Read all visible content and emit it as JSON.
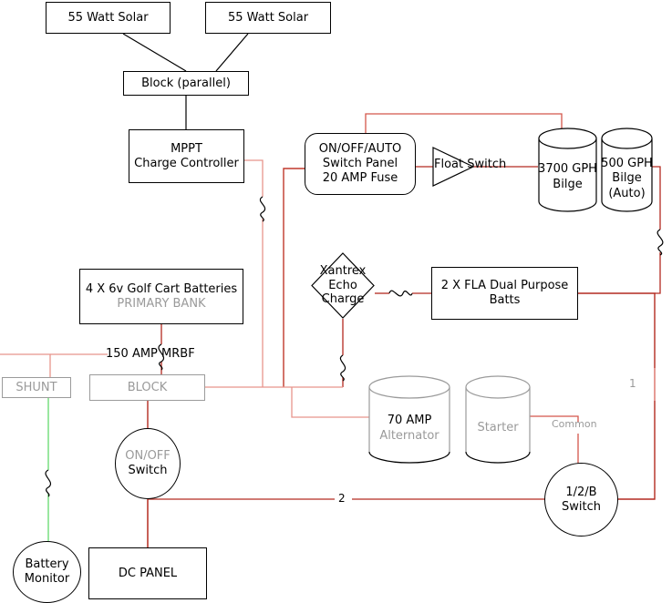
{
  "diagram": {
    "title": "Boat DC Electrical Wiring Diagram",
    "colors": {
      "wire_red_dark": "#b42a20",
      "wire_red_light": "#e8948c",
      "wire_red_mid": "#d4564a",
      "wire_green": "#6fdd78",
      "outline_black": "#000000",
      "outline_gray": "#9b9b9b",
      "text_black": "#000000",
      "text_gray": "#9a9a9a",
      "background": "#ffffff"
    },
    "nodes": [
      {
        "id": "solar_left",
        "shape": "rect",
        "label": "55 Watt Solar"
      },
      {
        "id": "solar_right",
        "shape": "rect",
        "label": "55 Watt Solar"
      },
      {
        "id": "block_parallel",
        "shape": "rect",
        "label": "Block (parallel)"
      },
      {
        "id": "mppt",
        "shape": "rect",
        "label_line1": "MPPT",
        "label_line2": "Charge Controller"
      },
      {
        "id": "switch_panel",
        "shape": "rounded",
        "label_line1": "ON/OFF/AUTO",
        "label_line2": "Switch Panel",
        "label_line3": "20 AMP Fuse"
      },
      {
        "id": "float_switch",
        "shape": "triangle",
        "label": "Float Switch"
      },
      {
        "id": "bilge_3700",
        "shape": "cylinder",
        "label_line1": "3700 GPH",
        "label_line2": "Bilge"
      },
      {
        "id": "bilge_500",
        "shape": "cylinder",
        "label_line1": "500 GPH",
        "label_line2": "Bilge",
        "label_line3": "(Auto)"
      },
      {
        "id": "primary_bank",
        "shape": "rect",
        "label_line1": "4 X 6v Golf Cart Batteries",
        "label_line2": "PRIMARY BANK"
      },
      {
        "id": "echo_charge",
        "shape": "diamond",
        "label_line1": "Xantrex",
        "label_line2": "Echo",
        "label_line3": "Charge"
      },
      {
        "id": "fla_batts",
        "shape": "rect",
        "label_line1": "2 X FLA Dual Purpose",
        "label_line2": "Batts"
      },
      {
        "id": "shunt",
        "shape": "rect",
        "label": "SHUNT"
      },
      {
        "id": "block",
        "shape": "rect",
        "label": "BLOCK"
      },
      {
        "id": "onoff_switch",
        "shape": "circle",
        "label_line1": "ON/OFF",
        "label_line2": "Switch"
      },
      {
        "id": "alternator",
        "shape": "cylinder",
        "label_line1": "70 AMP",
        "label_line2": "Alternator"
      },
      {
        "id": "starter",
        "shape": "cylinder",
        "label": "Starter"
      },
      {
        "id": "battery_switch",
        "shape": "circle",
        "label_line1": "1/2/B",
        "label_line2": "Switch"
      },
      {
        "id": "battery_monitor",
        "shape": "circle",
        "label_line1": "Battery",
        "label_line2": "Monitor"
      },
      {
        "id": "dc_panel",
        "shape": "rect",
        "label": "DC PANEL"
      }
    ],
    "labels": {
      "solar_left": "55 Watt Solar",
      "solar_right": "55 Watt Solar",
      "block_parallel": "Block (parallel)",
      "mppt_line1": "MPPT",
      "mppt_line2": "Charge Controller",
      "switch_panel_line1": "ON/OFF/AUTO",
      "switch_panel_line2": "Switch Panel",
      "switch_panel_line3": "20 AMP Fuse",
      "float_switch": "Float Switch",
      "bilge_3700_line1": "3700 GPH",
      "bilge_3700_line2": "Bilge",
      "bilge_500_line1": "500 GPH",
      "bilge_500_line2": "Bilge",
      "bilge_500_line3": "(Auto)",
      "primary_bank_line1": "4 X 6v Golf Cart Batteries",
      "primary_bank_line2": "PRIMARY BANK",
      "echo_line1": "Xantrex",
      "echo_line2": "Echo",
      "echo_line3": "Charge",
      "fla_line1": "2 X FLA Dual Purpose",
      "fla_line2": "Batts",
      "shunt": "SHUNT",
      "block": "BLOCK",
      "onoff_line1": "ON/OFF",
      "onoff_line2": "Switch",
      "alternator_line1": "70 AMP",
      "alternator_line2": "Alternator",
      "starter": "Starter",
      "batt_switch_line1": "1/2/B",
      "batt_switch_line2": "Switch",
      "batt_monitor_line1": "Battery",
      "batt_monitor_line2": "Monitor",
      "dc_panel": "DC PANEL",
      "fuse_mrbf": "150 AMP MRBF",
      "common": "Common",
      "terminal_1": "1",
      "terminal_2": "2"
    }
  }
}
